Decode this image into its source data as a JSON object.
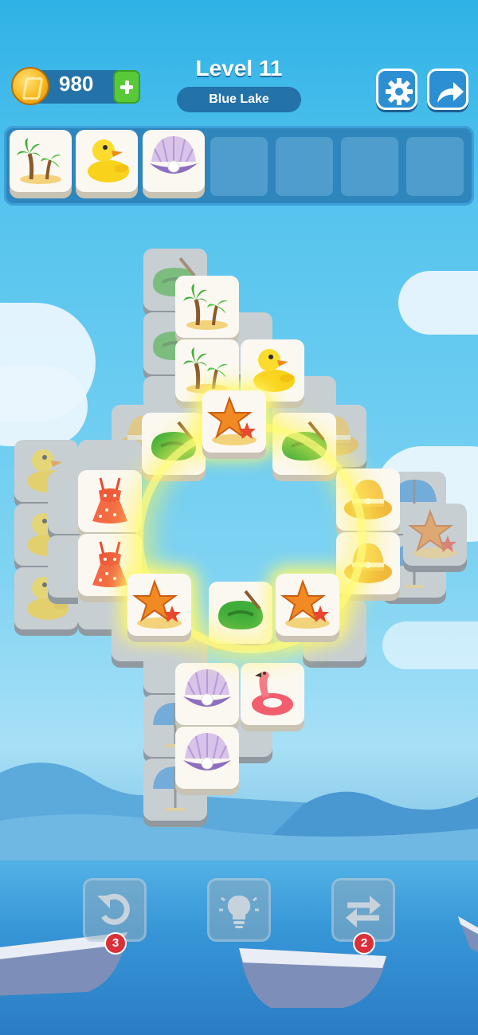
{
  "header": {
    "coins": "980",
    "level_title": "Level 11",
    "level_name": "Blue Lake"
  },
  "buttons": {
    "settings_icon": "gear-icon",
    "share_icon": "arrow-right-icon",
    "add_coins_icon": "plus-icon",
    "undo_icon": "undo-icon",
    "hint_icon": "lightbulb-icon",
    "shuffle_icon": "shuffle-icon"
  },
  "tray": {
    "capacity": 7,
    "items": [
      "palm-trees",
      "rubber-duck",
      "seashell-pearl"
    ]
  },
  "boosters": {
    "undo_count": "3",
    "shuffle_count": "2"
  },
  "colors": {
    "sky": "#55c4ee",
    "panel": "#2372a8",
    "badge": "#d9303a",
    "plus": "#59c93a",
    "glow": "#fff86b"
  }
}
